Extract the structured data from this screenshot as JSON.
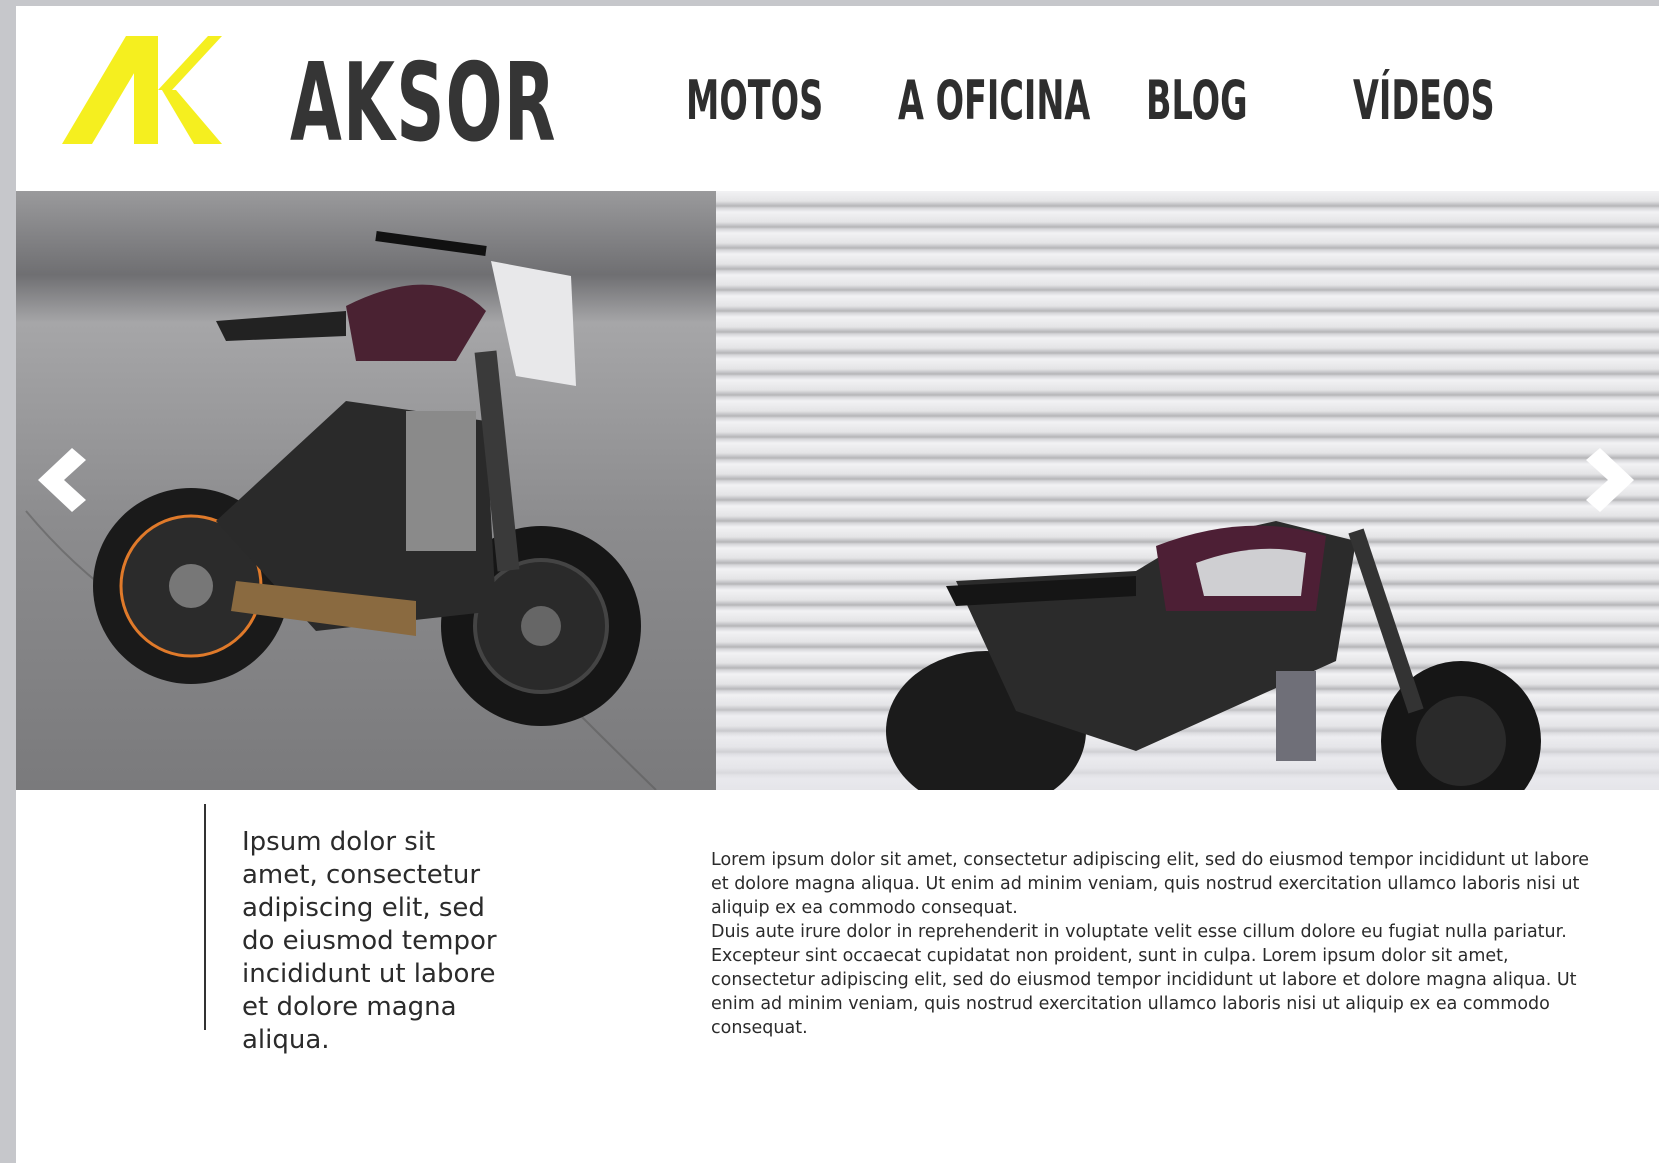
{
  "header": {
    "brand": "AKSOR",
    "logo_mark_icon": "ak-logo-mark",
    "brand_color": "#f5ef1f",
    "nav": [
      {
        "label": "MOTOS"
      },
      {
        "label": "A OFICINA"
      },
      {
        "label": "BLOG"
      },
      {
        "label": "VÍDEOS"
      }
    ]
  },
  "hero": {
    "slides": [
      {
        "image": "motorcycle-on-asphalt-photo"
      },
      {
        "image": "motorcycle-by-shutter-door-photo"
      }
    ],
    "prev_icon": "chevron-left-icon",
    "next_icon": "chevron-right-icon"
  },
  "content": {
    "quote": "Ipsum dolor sit amet, consectetur adipiscing elit, sed do eiusmod tempor incididunt ut labore et dolore magna aliqua.",
    "paragraph_1": "Lorem ipsum dolor sit amet, consectetur adipiscing elit, sed do eiusmod tempor incididunt ut labore et dolore magna aliqua. Ut enim ad minim veniam, quis nostrud exercitation ullamco laboris nisi ut aliquip ex ea commodo consequat.",
    "paragraph_2": "Duis aute irure dolor in reprehenderit in voluptate velit esse cillum dolore eu fugiat nulla pariatur. Excepteur sint occaecat cupidatat non proident, sunt in culpa. Lorem ipsum dolor sit amet, consectetur adipiscing elit, sed do eiusmod tempor incididunt ut labore et dolore magna aliqua. Ut enim ad minim veniam, quis nostrud exercitation ullamco laboris nisi ut aliquip ex ea commodo consequat."
  }
}
